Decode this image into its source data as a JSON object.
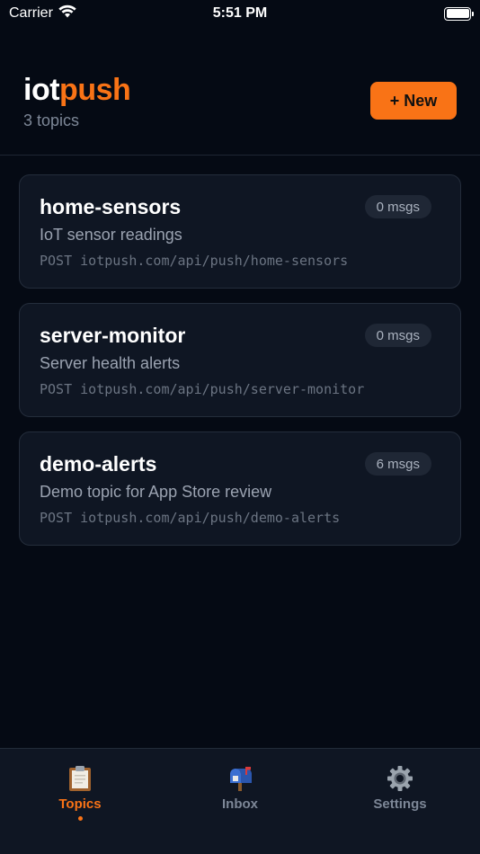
{
  "status_bar": {
    "carrier": "Carrier",
    "time": "5:51 PM"
  },
  "header": {
    "brand_part1": "iot",
    "brand_part2": "push",
    "subtitle": "3 topics",
    "new_button_label": "+ New"
  },
  "topics": [
    {
      "name": "home-sensors",
      "description": "IoT sensor readings",
      "endpoint": "POST iotpush.com/api/push/home-sensors",
      "badge": "0 msgs"
    },
    {
      "name": "server-monitor",
      "description": "Server health alerts",
      "endpoint": "POST iotpush.com/api/push/server-monitor",
      "badge": "0 msgs"
    },
    {
      "name": "demo-alerts",
      "description": "Demo topic for App Store review",
      "endpoint": "POST iotpush.com/api/push/demo-alerts",
      "badge": "6 msgs"
    }
  ],
  "tabs": [
    {
      "label": "Topics",
      "icon": "clipboard-icon",
      "active": true
    },
    {
      "label": "Inbox",
      "icon": "mailbox-icon",
      "active": false
    },
    {
      "label": "Settings",
      "icon": "gear-icon",
      "active": false
    }
  ],
  "colors": {
    "accent": "#f97316",
    "background": "#050a14",
    "card": "#0f1623"
  }
}
